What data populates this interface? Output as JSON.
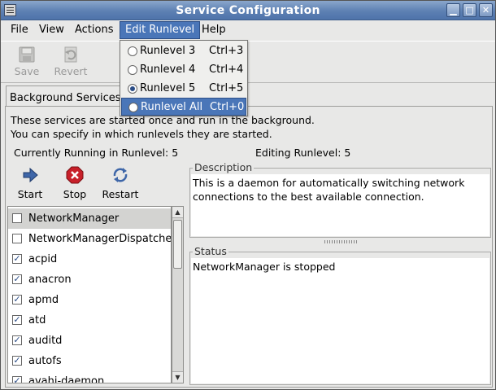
{
  "window": {
    "title": "Service Configuration",
    "controls": {
      "minimize": "▁",
      "maximize": "□",
      "close": "✕"
    }
  },
  "menubar": {
    "items": [
      {
        "label": "File"
      },
      {
        "label": "View"
      },
      {
        "label": "Actions"
      },
      {
        "label": "Edit Runlevel"
      },
      {
        "label": "Help"
      }
    ]
  },
  "toolbar": {
    "save_label": "Save",
    "revert_label": "Revert",
    "save_icon": "floppy-disk-icon",
    "revert_icon": "revert-icon"
  },
  "edit_runlevel_menu": {
    "items": [
      {
        "label": "Runlevel 3",
        "accel": "Ctrl+3",
        "checked": false
      },
      {
        "label": "Runlevel 4",
        "accel": "Ctrl+4",
        "checked": false
      },
      {
        "label": "Runlevel 5",
        "accel": "Ctrl+5",
        "checked": true
      },
      {
        "label": "Runlevel All",
        "accel": "Ctrl+0",
        "checked": false
      }
    ],
    "highlighted_index": 3
  },
  "tab": {
    "label": "Background Services"
  },
  "info": {
    "line1": "These services are started once and run in the background.",
    "line2": "You can specify in which runlevels they are started."
  },
  "runlevels": {
    "current": "Currently Running in Runlevel: 5",
    "editing": "Editing Runlevel: 5"
  },
  "service_actions": {
    "start_label": "Start",
    "stop_label": "Stop",
    "restart_label": "Restart"
  },
  "services": [
    {
      "name": "NetworkManager",
      "enabled": false,
      "selected": true
    },
    {
      "name": "NetworkManagerDispatcher",
      "enabled": false,
      "selected": false
    },
    {
      "name": "acpid",
      "enabled": true,
      "selected": false
    },
    {
      "name": "anacron",
      "enabled": true,
      "selected": false
    },
    {
      "name": "apmd",
      "enabled": true,
      "selected": false
    },
    {
      "name": "atd",
      "enabled": true,
      "selected": false
    },
    {
      "name": "auditd",
      "enabled": true,
      "selected": false
    },
    {
      "name": "autofs",
      "enabled": true,
      "selected": false
    },
    {
      "name": "avahi-daemon",
      "enabled": true,
      "selected": false
    }
  ],
  "description": {
    "label": "Description",
    "text": "This is a daemon for automatically switching network connections to the best available connection."
  },
  "status": {
    "label": "Status",
    "text": "NetworkManager is stopped"
  },
  "colors": {
    "titlebar": "#5d80b3",
    "menu_highlight": "#4a76b8",
    "stop_red": "#c8202a",
    "action_blue": "#2a4c86"
  }
}
